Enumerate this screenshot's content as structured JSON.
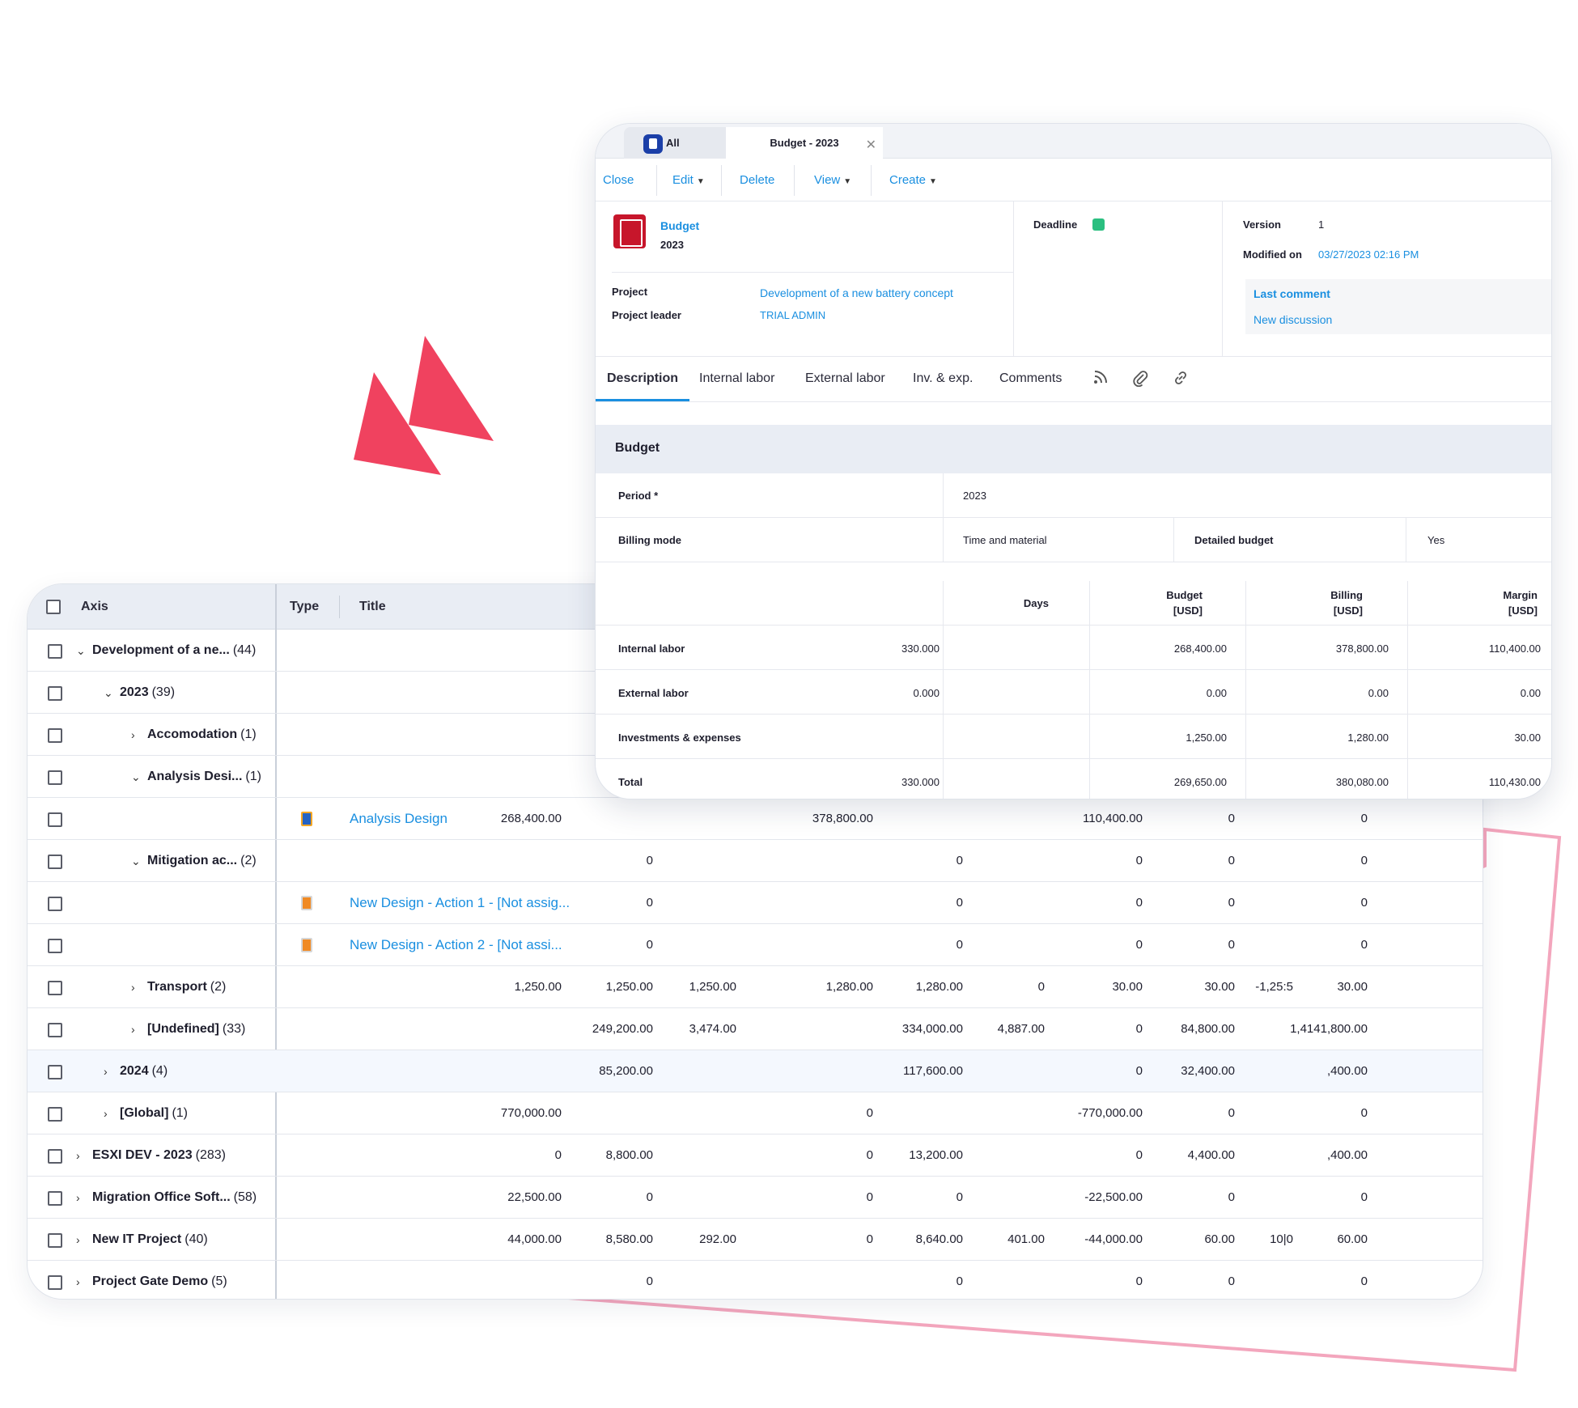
{
  "colors": {
    "accent": "#1a8fe0",
    "deco_red": "#f0425f",
    "deco_pink": "#f3a6bd",
    "deadline_green": "#2bbf80"
  },
  "grid": {
    "headers": {
      "axis": "Axis",
      "type": "Type",
      "title": "Title"
    },
    "rows": [
      {
        "axis": "Development of a ne...",
        "count": "(44)",
        "level": 0,
        "chevron": "down",
        "values": []
      },
      {
        "axis": "2023",
        "count": "(39)",
        "level": 1,
        "chevron": "down",
        "values": []
      },
      {
        "axis": "Accomodation",
        "count": "(1)",
        "level": 2,
        "chevron": "right",
        "values": []
      },
      {
        "axis": "Analysis Desi...",
        "count": "(1)",
        "level": 2,
        "chevron": "down",
        "values": []
      },
      {
        "axis": "",
        "count": "",
        "level": -1,
        "chevron": "",
        "type_icon": "blue",
        "title": "Analysis Design",
        "values": [
          "268,400.00",
          "",
          "",
          "378,800.00",
          "",
          "",
          "110,400.00",
          "0",
          "",
          "0"
        ]
      },
      {
        "axis": "Mitigation ac...",
        "count": "(2)",
        "level": 2,
        "chevron": "down",
        "values": [
          "",
          "0",
          "",
          "",
          "0",
          "",
          "0",
          "0",
          "",
          "0"
        ]
      },
      {
        "axis": "",
        "count": "",
        "level": -1,
        "chevron": "",
        "type_icon": "orange",
        "title": "New Design - Action 1 - [Not assig...",
        "values": [
          "",
          "0",
          "",
          "",
          "0",
          "",
          "0",
          "0",
          "",
          "0"
        ]
      },
      {
        "axis": "",
        "count": "",
        "level": -1,
        "chevron": "",
        "type_icon": "orange",
        "title": "New Design - Action 2 - [Not assi...",
        "values": [
          "",
          "0",
          "",
          "",
          "0",
          "",
          "0",
          "0",
          "",
          "0"
        ]
      },
      {
        "axis": "Transport",
        "count": "(2)",
        "level": 2,
        "chevron": "right",
        "values": [
          "1,250.00",
          "1,250.00",
          "1,250.00",
          "1,280.00",
          "1,280.00",
          "0",
          "30.00",
          "30.00",
          "-1,25:5",
          "30.00"
        ]
      },
      {
        "axis": "[Undefined]",
        "count": "(33)",
        "level": 2,
        "chevron": "right",
        "values": [
          "",
          "249,200.00",
          "3,474.00",
          "",
          "334,000.00",
          "4,887.00",
          "0",
          "84,800.00",
          "",
          "1,4141,800.00"
        ]
      },
      {
        "axis": "2024",
        "count": "(4)",
        "level": 1,
        "chevron": "right",
        "alt": true,
        "values": [
          "",
          "85,200.00",
          "",
          "",
          "117,600.00",
          "",
          "0",
          "32,400.00",
          "",
          ",400.00"
        ]
      },
      {
        "axis": "[Global]",
        "count": "(1)",
        "level": 1,
        "chevron": "right",
        "values": [
          "770,000.00",
          "",
          "",
          "0",
          "",
          "",
          "-770,000.00",
          "0",
          "",
          "0"
        ]
      },
      {
        "axis": "ESXI DEV - 2023",
        "count": "(283)",
        "level": 0,
        "chevron": "right",
        "values": [
          "0",
          "8,800.00",
          "",
          "0",
          "13,200.00",
          "",
          "0",
          "4,400.00",
          "",
          ",400.00"
        ]
      },
      {
        "axis": "Migration Office Soft...",
        "count": "(58)",
        "level": 0,
        "chevron": "right",
        "values": [
          "22,500.00",
          "0",
          "",
          "0",
          "0",
          "",
          "-22,500.00",
          "0",
          "",
          "0"
        ]
      },
      {
        "axis": "New IT Project",
        "count": "(40)",
        "level": 0,
        "chevron": "right",
        "values": [
          "44,000.00",
          "8,580.00",
          "292.00",
          "0",
          "8,640.00",
          "401.00",
          "-44,000.00",
          "60.00",
          "10|0",
          "60.00"
        ]
      },
      {
        "axis": "Project Gate Demo",
        "count": "(5)",
        "level": 0,
        "chevron": "right",
        "values": [
          "",
          "0",
          "",
          "",
          "0",
          "",
          "0",
          "0",
          "",
          "0"
        ]
      }
    ]
  },
  "detail": {
    "tabs": {
      "all": "All",
      "current": "Budget - 2023"
    },
    "toolbar": {
      "close": "Close",
      "edit": "Edit",
      "delete": "Delete",
      "view": "View",
      "create": "Create"
    },
    "header": {
      "type": "Budget",
      "name": "2023",
      "project_label": "Project",
      "project_value": "Development of a new battery concept",
      "leader_label": "Project leader",
      "leader_value": "TRIAL ADMIN",
      "deadline_label": "Deadline",
      "version_label": "Version",
      "version_value": "1",
      "modified_label": "Modified on",
      "modified_value": "03/27/2023 02:16 PM",
      "last_comment": "Last comment",
      "new_discussion": "New discussion"
    },
    "subtabs": [
      "Description",
      "Internal labor",
      "External labor",
      "Inv. & exp.",
      "Comments"
    ],
    "section_title": "Budget",
    "fields": {
      "period_label": "Period *",
      "period_value": "2023",
      "billing_mode_label": "Billing mode",
      "billing_mode_value": "Time and material",
      "detailed_label": "Detailed budget",
      "detailed_value": "Yes"
    },
    "table": {
      "headers": {
        "days": "Days",
        "budget": "Budget",
        "billing": "Billing",
        "margin": "Margin",
        "unit": "[USD]"
      },
      "rows": [
        {
          "label": "Internal labor",
          "days": "330.000",
          "budget": "268,400.00",
          "billing": "378,800.00",
          "margin": "110,400.00"
        },
        {
          "label": "External labor",
          "days": "0.000",
          "budget": "0.00",
          "billing": "0.00",
          "margin": "0.00"
        },
        {
          "label": "Investments & expenses",
          "days": "",
          "budget": "1,250.00",
          "billing": "1,280.00",
          "margin": "30.00"
        },
        {
          "label": "Total",
          "days": "330.000",
          "budget": "269,650.00",
          "billing": "380,080.00",
          "margin": "110,430.00"
        }
      ]
    }
  }
}
